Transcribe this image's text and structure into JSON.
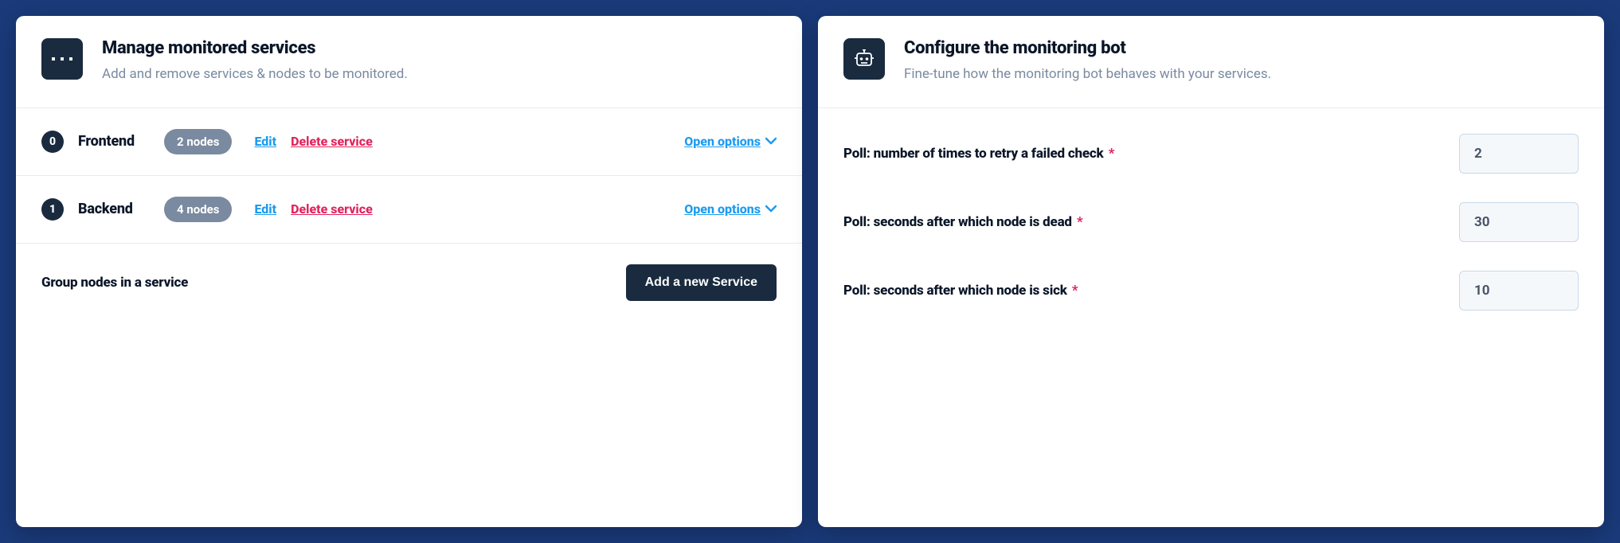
{
  "services_card": {
    "title": "Manage monitored services",
    "subtitle": "Add and remove services & nodes to be monitored.",
    "edit_label": "Edit",
    "delete_label": "Delete service",
    "open_label": "Open options",
    "footer_text": "Group nodes in a service",
    "add_button": "Add a new Service",
    "items": [
      {
        "idx": "0",
        "name": "Frontend",
        "nodes": "2 nodes"
      },
      {
        "idx": "1",
        "name": "Backend",
        "nodes": "4 nodes"
      }
    ]
  },
  "config_card": {
    "title": "Configure the monitoring bot",
    "subtitle": "Fine-tune how the monitoring bot behaves with your services.",
    "fields": [
      {
        "label": "Poll: number of times to retry a failed check",
        "value": "2"
      },
      {
        "label": "Poll: seconds after which node is dead",
        "value": "30"
      },
      {
        "label": "Poll: seconds after which node is sick",
        "value": "10"
      }
    ]
  }
}
